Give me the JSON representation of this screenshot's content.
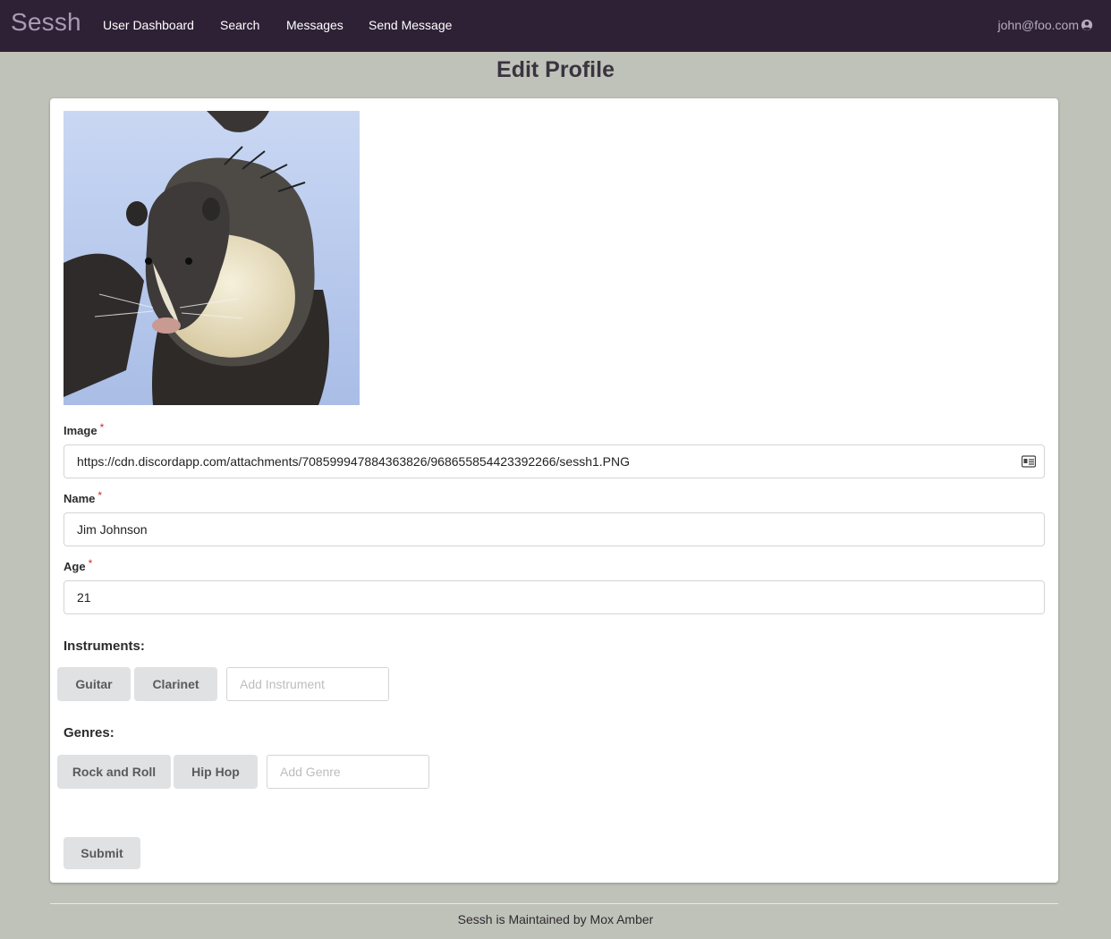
{
  "nav": {
    "brand": "Sessh",
    "items": [
      "User Dashboard",
      "Search",
      "Messages",
      "Send Message"
    ],
    "user_email": "john@foo.com",
    "user_icon": "user-circle-icon"
  },
  "page_title": "Edit Profile",
  "form": {
    "image_label": "Image",
    "image_value": "https://cdn.discordapp.com/attachments/708599947884363826/968655854423392266/sessh1.PNG",
    "name_label": "Name",
    "name_value": "Jim Johnson",
    "age_label": "Age",
    "age_value": "21",
    "required_mark": "*",
    "instruments_title": "Instruments:",
    "instruments": [
      "Guitar",
      "Clarinet"
    ],
    "instrument_placeholder": "Add Instrument",
    "genres_title": "Genres:",
    "genres": [
      "Rock and Roll",
      "Hip Hop"
    ],
    "genre_placeholder": "Add Genre",
    "submit_label": "Submit"
  },
  "footer": "Sessh is Maintained by Mox Amber"
}
